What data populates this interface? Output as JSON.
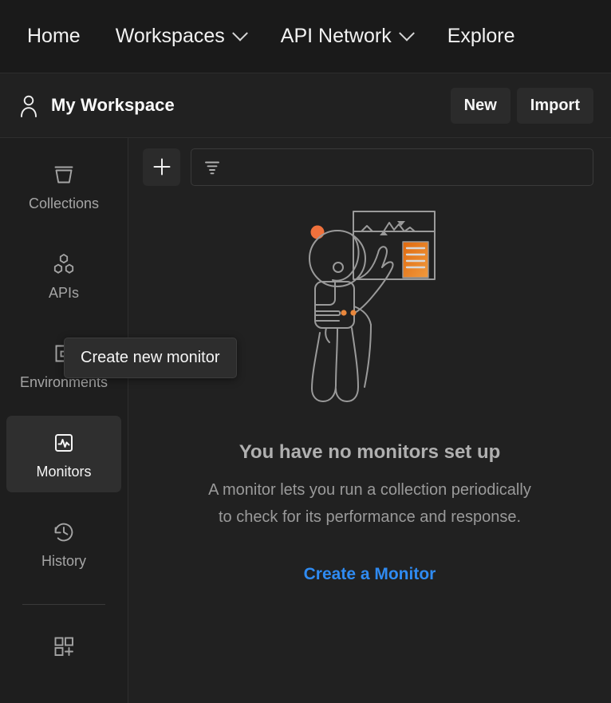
{
  "topnav": {
    "items": [
      {
        "label": "Home",
        "has_chevron": false,
        "icon": ""
      },
      {
        "label": "Workspaces",
        "has_chevron": true,
        "icon": "chevron-down-icon"
      },
      {
        "label": "API Network",
        "has_chevron": true,
        "icon": "chevron-down-icon"
      },
      {
        "label": "Explore",
        "has_chevron": false,
        "icon": ""
      }
    ]
  },
  "workspace_bar": {
    "icon": "person-icon",
    "title": "My Workspace",
    "new_label": "New",
    "import_label": "Import"
  },
  "sidebar": {
    "items": [
      {
        "label": "Collections",
        "icon": "collections-icon",
        "active": false
      },
      {
        "label": "APIs",
        "icon": "apis-icon",
        "active": false
      },
      {
        "label": "Environments",
        "icon": "environments-icon",
        "active": false
      },
      {
        "label": "Monitors",
        "icon": "monitors-icon",
        "active": true
      },
      {
        "label": "History",
        "icon": "history-icon",
        "active": false
      }
    ],
    "bottom_icon": "add-apps-grid-icon"
  },
  "toolbar": {
    "create_icon": "plus-icon",
    "filter_icon": "filter-sort-icon",
    "filter_placeholder": ""
  },
  "tooltip": {
    "text": "Create new monitor"
  },
  "empty_state": {
    "illustration": "astronaut-monitor-dashboard-illustration",
    "title": "You have no monitors set up",
    "description_line1": "A monitor lets you run a collection periodically",
    "description_line2": "to check for its performance and response.",
    "link_label": "Create a Monitor"
  },
  "colors": {
    "app_background": "#1e1e1e",
    "topnav_background": "#1a1a1a",
    "panel_background": "#212121",
    "active_item_background": "#2f2f2f",
    "border": "#2e2e2e",
    "text_primary": "#f5f5f5",
    "text_muted": "#9a9a9a",
    "accent_link": "#2f8bf2",
    "accent_orange": "#f0713c",
    "illustration_stroke": "#9a9a9a"
  }
}
